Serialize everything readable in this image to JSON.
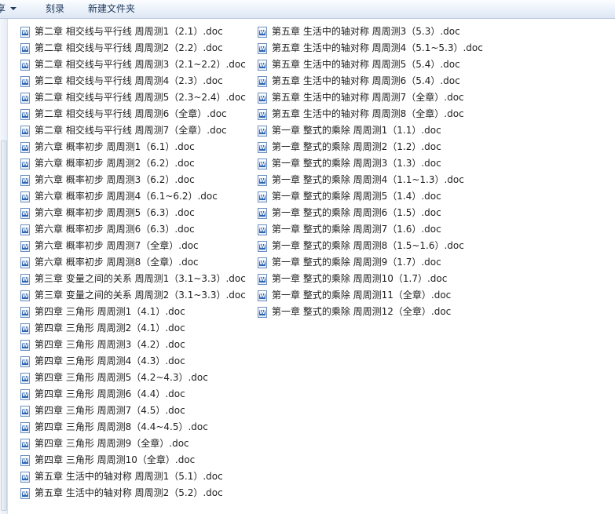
{
  "toolbar": {
    "share_label": "享",
    "burn_label": "刻录",
    "new_folder_label": "新建文件夹"
  },
  "files_left": [
    "第二章 相交线与平行线 周周测1（2.1）.doc",
    "第二章 相交线与平行线 周周测2（2.2）.doc",
    "第二章 相交线与平行线 周周测3（2.1~2.2）.doc",
    "第二章 相交线与平行线 周周测4（2.3）.doc",
    "第二章 相交线与平行线 周周测5（2.3~2.4）.doc",
    "第二章 相交线与平行线 周周测6（全章）.doc",
    "第二章 相交线与平行线 周周测7（全章）.doc",
    "第六章 概率初步 周周测1（6.1）.doc",
    "第六章 概率初步 周周测2（6.2）.doc",
    "第六章 概率初步 周周测3（6.2）.doc",
    "第六章 概率初步 周周测4（6.1~6.2）.doc",
    "第六章 概率初步 周周测5（6.3）.doc",
    "第六章 概率初步 周周测6（6.3）.doc",
    "第六章 概率初步 周周测7（全章）.doc",
    "第六章 概率初步 周周测8（全章）.doc",
    "第三章 变量之间的关系 周周测1（3.1~3.3）.doc",
    "第三章 变量之间的关系 周周测2（3.1~3.3）.doc",
    "第四章 三角形 周周测1（4.1）.doc",
    "第四章 三角形 周周测2（4.1）.doc",
    "第四章 三角形 周周测3（4.2）.doc",
    "第四章 三角形 周周测4（4.3）.doc",
    "第四章 三角形 周周测5（4.2~4.3）.doc",
    "第四章 三角形 周周测6（4.4）.doc",
    "第四章 三角形 周周测7（4.5）.doc",
    "第四章 三角形 周周测8（4.4~4.5）.doc",
    "第四章 三角形 周周测9（全章）.doc",
    "第四章 三角形 周周测10（全章）.doc",
    "第五章 生活中的轴对称 周周测1（5.1）.doc",
    "第五章 生活中的轴对称 周周测2（5.2）.doc"
  ],
  "files_right": [
    "第五章 生活中的轴对称 周周测3（5.3）.doc",
    "第五章 生活中的轴对称 周周测4（5.1~5.3）.doc",
    "第五章 生活中的轴对称 周周测5（5.4）.doc",
    "第五章 生活中的轴对称 周周测6（5.4）.doc",
    "第五章 生活中的轴对称 周周测7（全章）.doc",
    "第五章 生活中的轴对称 周周测8（全章）.doc",
    "第一章 整式的乘除 周周测1（1.1）.doc",
    "第一章 整式的乘除 周周测2（1.2）.doc",
    "第一章 整式的乘除 周周测3（1.3）.doc",
    "第一章 整式的乘除 周周测4（1.1~1.3）.doc",
    "第一章 整式的乘除 周周测5（1.4）.doc",
    "第一章 整式的乘除 周周测6（1.5）.doc",
    "第一章 整式的乘除 周周测7（1.6）.doc",
    "第一章 整式的乘除 周周测8（1.5~1.6）.doc",
    "第一章 整式的乘除 周周测9（1.7）.doc",
    "第一章 整式的乘除 周周测10（1.7）.doc",
    "第一章 整式的乘除 周周测11（全章）.doc",
    "第一章 整式的乘除 周周测12（全章）.doc"
  ],
  "icons": {
    "file": "word-document-icon",
    "dropdown": "chevron-down-icon"
  }
}
